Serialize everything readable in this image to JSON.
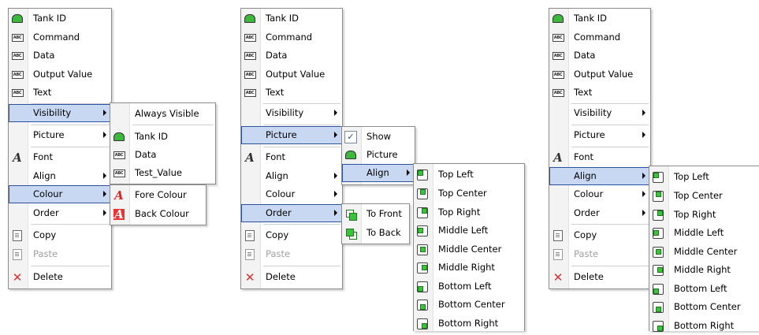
{
  "colors": {
    "highlight": "#c8d8f2",
    "highlight_border": "#2f4f9f",
    "green": "#3cc23c",
    "red": "#e03030"
  },
  "menus": {
    "main": {
      "tank_id": "Tank ID",
      "command": "Command",
      "data": "Data",
      "output_value": "Output Value",
      "text": "Text",
      "visibility": "Visibility",
      "picture": "Picture",
      "font": "Font",
      "align": "Align",
      "colour": "Colour",
      "order": "Order",
      "copy": "Copy",
      "paste": "Paste",
      "delete": "Delete"
    },
    "visibility_sub": {
      "always_visible": "Always Visible",
      "tank_id": "Tank ID",
      "data": "Data",
      "test_value": "Test_Value"
    },
    "colour_sub": {
      "fore_colour": "Fore Colour",
      "back_colour": "Back Colour"
    },
    "picture_sub": {
      "show": "Show",
      "picture": "Picture",
      "align": "Align"
    },
    "order_sub": {
      "to_front": "To Front",
      "to_back": "To Back"
    },
    "align_sub": {
      "top_left": "Top Left",
      "top_center": "Top Center",
      "top_right": "Top Right",
      "middle_left": "Middle Left",
      "middle_center": "Middle Center",
      "middle_right": "Middle Right",
      "bottom_left": "Bottom Left",
      "bottom_center": "Bottom Center",
      "bottom_right": "Bottom Right"
    }
  },
  "icons": {
    "abc": "ABC",
    "font": "A",
    "delete": "✕",
    "check": "✓"
  }
}
